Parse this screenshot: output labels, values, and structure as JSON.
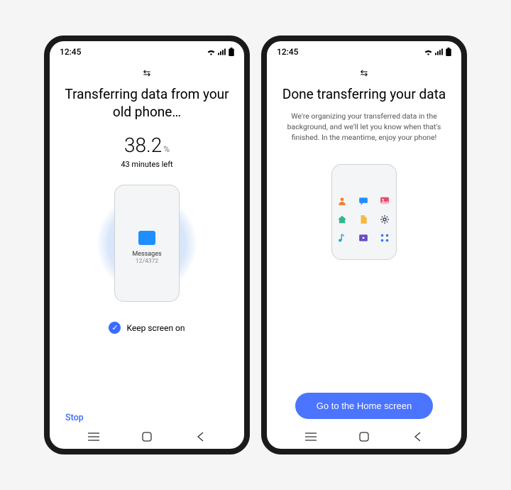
{
  "status": {
    "time": "12:45"
  },
  "left": {
    "title": "Transferring data from your old phone…",
    "percent": "38.2",
    "percent_unit": "%",
    "time_left": "43 minutes left",
    "current_item": {
      "label": "Messages",
      "progress": "12/4372"
    },
    "keep_screen_label": "Keep screen on",
    "stop_label": "Stop"
  },
  "right": {
    "title": "Done transferring your data",
    "subtitle": "We're organizing your transferred data in the background, and we'll let you know when that's finished. In the meantime, enjoy your phone!",
    "button_label": "Go to the Home screen",
    "apps": [
      "contacts-icon",
      "messages-icon",
      "gallery-icon",
      "home-icon",
      "files-icon",
      "settings-icon",
      "music-icon",
      "video-icon",
      "apps-icon"
    ]
  }
}
